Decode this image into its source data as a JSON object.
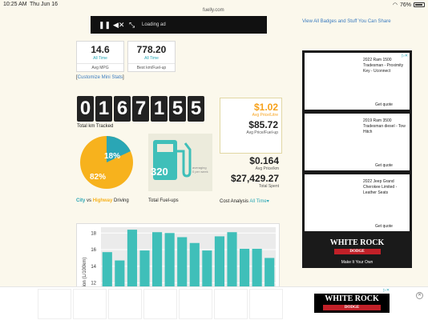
{
  "status": {
    "time": "10:25 AM",
    "date": "Thu Jun 16",
    "url": "fuelly.com",
    "battery": "76%"
  },
  "video": {
    "label": "Loading ad"
  },
  "mini_stats": [
    {
      "value": "14.6",
      "sub": "All Time",
      "label": "Avg MPG"
    },
    {
      "value": "778.20",
      "sub": "All Time",
      "label": "Best km/Fuel-up"
    }
  ],
  "customize": {
    "open": "[",
    "link": "Customize Mini Stats",
    "close": "]"
  },
  "odometer": {
    "digits": [
      "0",
      "1",
      "6",
      "7",
      "1",
      "5",
      "5"
    ],
    "label": "Total km Tracked"
  },
  "driving": {
    "city_pct": 18,
    "highway_pct": 82,
    "city_label": "18%",
    "highway_label": "82%",
    "city": "City",
    "vs": " vs ",
    "highway": "Highway",
    "suffix": " Driving",
    "colors": {
      "city": "#2aa6b5",
      "highway": "#f7b21d"
    }
  },
  "fuelups": {
    "count": "320",
    "note1": "averaging",
    "note2": "0 per week",
    "label": "Total Fuel-ups"
  },
  "cost": {
    "price": "$1.02",
    "price_label": "Avg Price/Litre",
    "fuelup": "$85.72",
    "fuelup_label": "Avg Price/Fuel-up",
    "km": "$0.164",
    "km_label": "Avg Price/km",
    "total": "$27,429.27",
    "total_label": "Total Spent",
    "analysis": "Cost Analysis",
    "range": "All Time"
  },
  "chart_data": {
    "type": "bar",
    "ylabel": "tion (L/100km)",
    "yticks": [
      12,
      14,
      16,
      18
    ],
    "ylim": [
      11,
      18.7
    ],
    "values": [
      15.7,
      14.7,
      18.4,
      15.9,
      18.1,
      18.0,
      17.5,
      16.8,
      15.9,
      17.6,
      18.1,
      16.1,
      16.1,
      15.0
    ],
    "color": "#3fbfb9"
  },
  "sidebar": {
    "link": "View All Badges and Stuff You Can Share"
  },
  "ads": [
    {
      "title": "2022 Ram 1500 Tradesman - Proximity Key - Uconnect",
      "cta": "Get quote"
    },
    {
      "title": "2019 Ram 3500 Tradesman diesel - Tow Hitch",
      "cta": "Get quote"
    },
    {
      "title": "2022 Jeep Grand Cherokee Limited - Leather Seats",
      "cta": "Get quote"
    }
  ],
  "ad_tag": "▷✕",
  "brand": {
    "name": "WHITE ROCK",
    "sub": "DODGE",
    "tagline": "Make It Your Own"
  },
  "close": "✕"
}
